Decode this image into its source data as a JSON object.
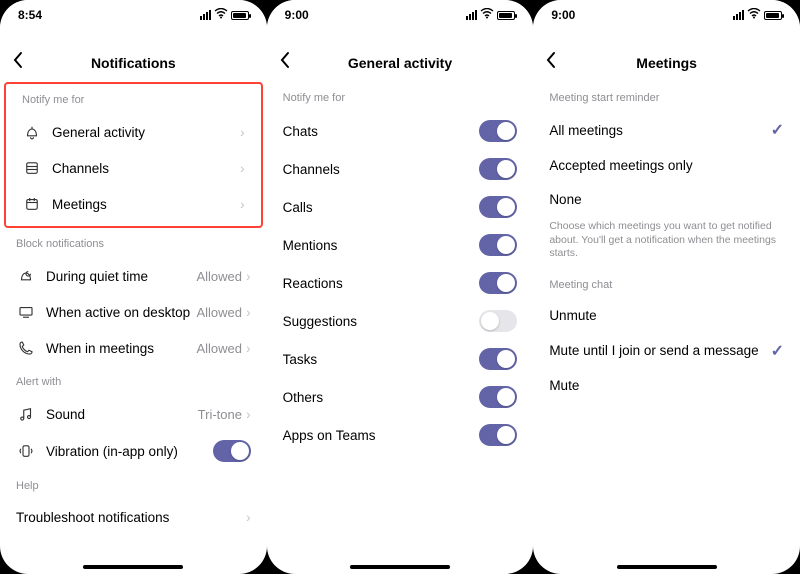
{
  "screen1": {
    "time": "8:54",
    "title": "Notifications",
    "sections": {
      "notify_header": "Notify me for",
      "notify_items": [
        "General activity",
        "Channels",
        "Meetings"
      ],
      "block_header": "Block notifications",
      "block_items": [
        {
          "label": "During quiet time",
          "value": "Allowed"
        },
        {
          "label": "When active on desktop",
          "value": "Allowed"
        },
        {
          "label": "When in meetings",
          "value": "Allowed"
        }
      ],
      "alert_header": "Alert with",
      "alert_sound": {
        "label": "Sound",
        "value": "Tri-tone"
      },
      "alert_vibration": "Vibration (in-app only)",
      "help_header": "Help",
      "help_item": "Troubleshoot notifications"
    }
  },
  "screen2": {
    "time": "9:00",
    "title": "General activity",
    "header": "Notify me for",
    "items": [
      {
        "label": "Chats",
        "on": true
      },
      {
        "label": "Channels",
        "on": true
      },
      {
        "label": "Calls",
        "on": true
      },
      {
        "label": "Mentions",
        "on": true
      },
      {
        "label": "Reactions",
        "on": true
      },
      {
        "label": "Suggestions",
        "on": false
      },
      {
        "label": "Tasks",
        "on": true
      },
      {
        "label": "Others",
        "on": true
      },
      {
        "label": "Apps on Teams",
        "on": true
      }
    ]
  },
  "screen3": {
    "time": "9:00",
    "title": "Meetings",
    "start_header": "Meeting start reminder",
    "start_items": [
      {
        "label": "All meetings",
        "checked": true
      },
      {
        "label": "Accepted meetings only",
        "checked": false
      },
      {
        "label": "None",
        "checked": false
      }
    ],
    "explain": "Choose which meetings you want to get notified about. You'll get a notification when the meetings starts.",
    "chat_header": "Meeting chat",
    "chat_items": [
      {
        "label": "Unmute",
        "checked": false
      },
      {
        "label": "Mute until I join or send a message",
        "checked": true
      },
      {
        "label": "Mute",
        "checked": false
      }
    ]
  }
}
